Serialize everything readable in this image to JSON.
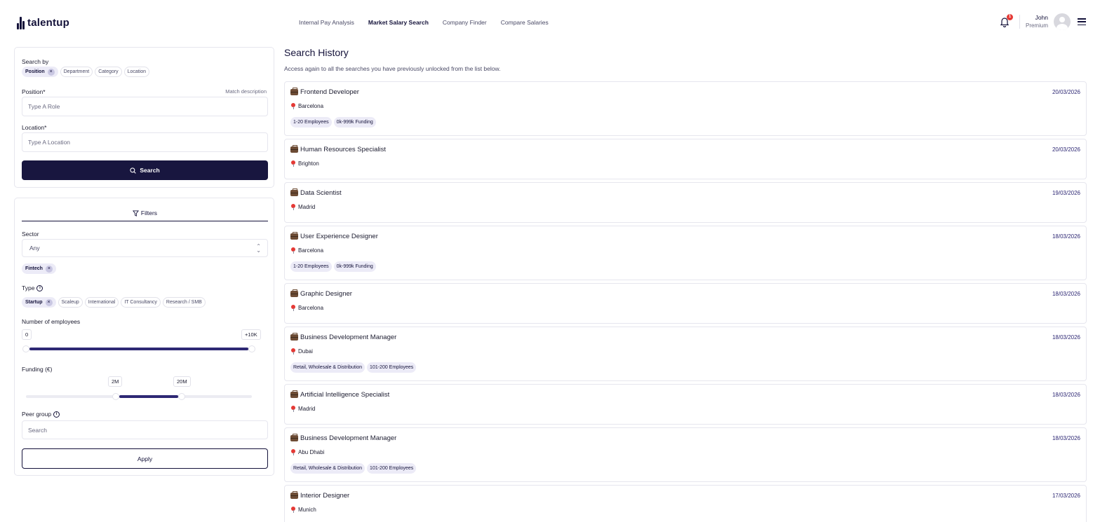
{
  "brand": {
    "name": "talentup"
  },
  "nav": [
    {
      "label": "Internal Pay Analysis",
      "active": false
    },
    {
      "label": "Market Salary Search",
      "active": true
    },
    {
      "label": "Company Finder",
      "active": false
    },
    {
      "label": "Compare Salaries",
      "active": false
    }
  ],
  "notifications": {
    "count": "1"
  },
  "user": {
    "name": "John",
    "plan": "Premium"
  },
  "search": {
    "search_by_label": "Search by",
    "search_by_options": [
      {
        "label": "Position",
        "selected": true
      },
      {
        "label": "Department",
        "selected": false
      },
      {
        "label": "Category",
        "selected": false
      },
      {
        "label": "Location",
        "selected": false
      }
    ],
    "position_label": "Position*",
    "match_description": "Match description",
    "position_placeholder": "Type A Role",
    "location_label": "Location*",
    "location_placeholder": "Type A Location",
    "search_button": "Search"
  },
  "filters": {
    "tab_label": "Filters",
    "sector_label": "Sector",
    "sector_value": "Any",
    "sector_chips": [
      "Fintech"
    ],
    "type_label": "Type",
    "type_options": [
      {
        "label": "Startup",
        "selected": true
      },
      {
        "label": "Scaleup",
        "selected": false
      },
      {
        "label": "International",
        "selected": false
      },
      {
        "label": "IT Consultancy",
        "selected": false
      },
      {
        "label": "Research / SMB",
        "selected": false
      }
    ],
    "employees_label": "Number of employees",
    "employees_min": "0",
    "employees_max": "+10K",
    "funding_label": "Funding (€)",
    "funding_min": "2M",
    "funding_max": "20M",
    "peer_group_label": "Peer group",
    "peer_group_placeholder": "Search",
    "apply_button": "Apply"
  },
  "history": {
    "title": "Search History",
    "subtitle": "Access again to all the searches you have previously unlocked from the list below.",
    "items": [
      {
        "title": "Frontend Developer",
        "location": "Barcelona",
        "date": "20/03/2026",
        "tags": [
          "1-20 Employees",
          "0k-999k Funding"
        ]
      },
      {
        "title": "Human Resources Specialist",
        "location": "Brighton",
        "date": "20/03/2026",
        "tags": []
      },
      {
        "title": "Data Scientist",
        "location": "Madrid",
        "date": "19/03/2026",
        "tags": []
      },
      {
        "title": "User Experience Designer",
        "location": "Barcelona",
        "date": "18/03/2026",
        "tags": [
          "1-20 Employees",
          "0k-999k Funding"
        ]
      },
      {
        "title": "Graphic Designer",
        "location": "Barcelona",
        "date": "18/03/2026",
        "tags": []
      },
      {
        "title": "Business Development Manager",
        "location": "Dubai",
        "date": "18/03/2026",
        "tags": [
          "Retail, Wholesale & Distribution",
          "101-200 Employees"
        ]
      },
      {
        "title": "Artificial Intelligence Specialist",
        "location": "Madrid",
        "date": "18/03/2026",
        "tags": []
      },
      {
        "title": "Business Development Manager",
        "location": "Abu Dhabi",
        "date": "18/03/2026",
        "tags": [
          "Retail, Wholesale & Distribution",
          "101-200 Employees"
        ]
      },
      {
        "title": "Interior Designer",
        "location": "Munich",
        "date": "17/03/2026",
        "tags": []
      }
    ]
  }
}
